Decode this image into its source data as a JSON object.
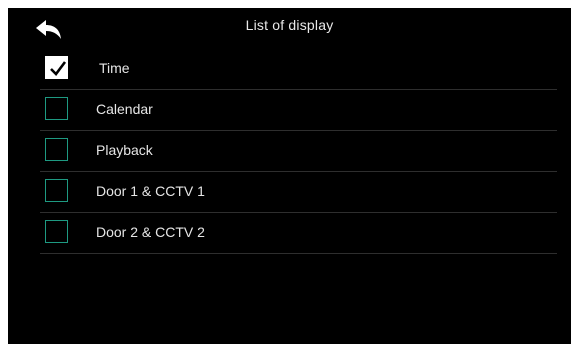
{
  "header": {
    "title": "List of display",
    "back_icon": "back-arrow-icon"
  },
  "colors": {
    "background": "#000000",
    "checkbox_border": "#1e9a82",
    "divider": "#2e2e2e",
    "text": "#e6e6e6"
  },
  "items": [
    {
      "label": "Time",
      "checked": true
    },
    {
      "label": "Calendar",
      "checked": false
    },
    {
      "label": "Playback",
      "checked": false
    },
    {
      "label": "Door 1 & CCTV 1",
      "checked": false
    },
    {
      "label": "Door 2 & CCTV 2",
      "checked": false
    }
  ]
}
